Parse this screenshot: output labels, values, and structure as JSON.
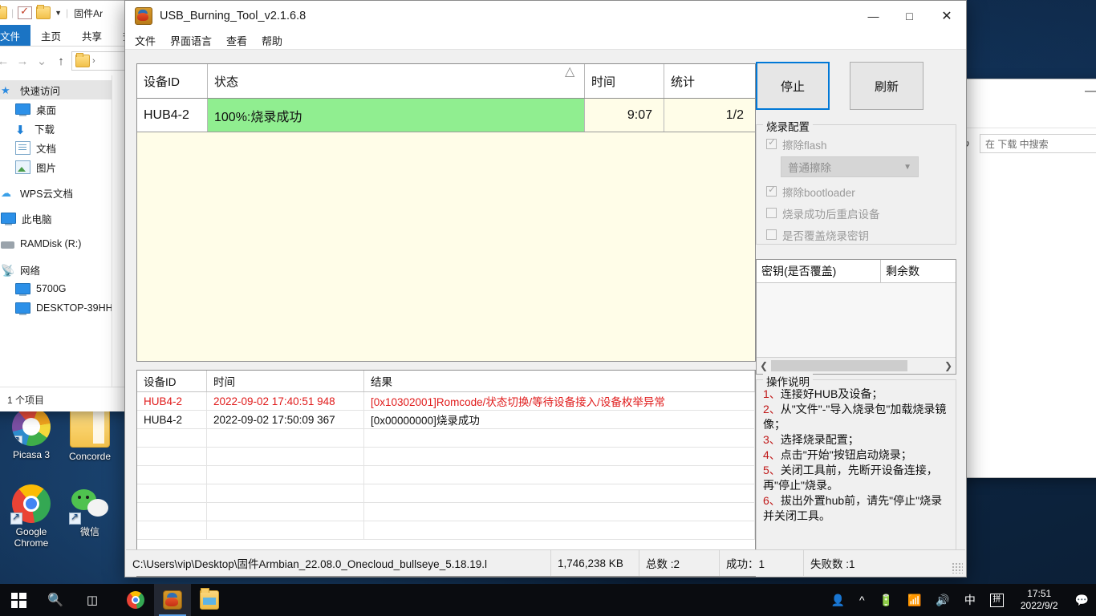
{
  "desktop": {
    "icons": [
      {
        "label": "Picasa 3",
        "icon": "picasa-icon"
      },
      {
        "label": "Concorde",
        "icon": "folder-icon"
      },
      {
        "label": "Google Chrome",
        "icon": "chrome-icon"
      },
      {
        "label": "微信",
        "icon": "wechat-icon"
      }
    ]
  },
  "explorer": {
    "title": "固件Ar",
    "quick_access_icons": [
      "folder-icon",
      "properties-icon",
      "new-folder-icon",
      "customize-caret-icon"
    ],
    "ribbon_tabs": [
      {
        "label": "文件",
        "active": true
      },
      {
        "label": "主页",
        "active": false
      },
      {
        "label": "共享",
        "active": false
      },
      {
        "label": "查看",
        "active": false
      }
    ],
    "nav": {
      "back": "←",
      "forward": "→",
      "recent": "⌄",
      "up": "↑",
      "path_chevron": "›"
    },
    "tree": [
      {
        "label": "快速访问",
        "icon": "pin-icon",
        "selected": true,
        "indent": false
      },
      {
        "label": "桌面",
        "icon": "desktop-icon",
        "selected": false,
        "indent": true
      },
      {
        "label": "下载",
        "icon": "download-icon",
        "selected": false,
        "indent": true
      },
      {
        "label": "文档",
        "icon": "documents-icon",
        "selected": false,
        "indent": true
      },
      {
        "label": "图片",
        "icon": "pictures-icon",
        "selected": false,
        "indent": true
      },
      {
        "label": "WPS云文档",
        "icon": "cloud-icon",
        "selected": false,
        "indent": false
      },
      {
        "label": "此电脑",
        "icon": "computer-icon",
        "selected": false,
        "indent": false
      },
      {
        "label": "RAMDisk (R:)",
        "icon": "drive-icon",
        "selected": false,
        "indent": false
      },
      {
        "label": "网络",
        "icon": "network-icon",
        "selected": false,
        "indent": false
      },
      {
        "label": "5700G",
        "icon": "computer-icon",
        "selected": false,
        "indent": true
      },
      {
        "label": "DESKTOP-39HH",
        "icon": "computer-icon",
        "selected": false,
        "indent": true
      }
    ],
    "status": "1 个项目"
  },
  "explorer2": {
    "minimize": "—",
    "refresh_icon": "refresh-icon",
    "search_placeholder": "在 下载 中搜索"
  },
  "usb_tool": {
    "title": "USB_Burning_Tool_v2.1.6.8",
    "app_icon": "usb-burning-tool-icon",
    "window_buttons": {
      "minimize": "—",
      "maximize": "□",
      "close": "✕"
    },
    "menu": [
      "文件",
      "界面语言",
      "查看",
      "帮助"
    ],
    "device_grid": {
      "headers": [
        "设备ID",
        "状态",
        "时间",
        "统计"
      ],
      "sort_indicator": "△",
      "rows": [
        {
          "id": "HUB4-2",
          "status": "100%:烧录成功",
          "time": "9:07",
          "stat": "1/2",
          "color": "#90ee90"
        }
      ]
    },
    "log_grid": {
      "headers": [
        "设备ID",
        "时间",
        "结果"
      ],
      "rows": [
        {
          "id": "HUB4-2",
          "time": "2022-09-02 17:40:51 948",
          "result": "[0x10302001]Romcode/状态切换/等待设备接入/设备枚举异常",
          "error": true
        },
        {
          "id": "HUB4-2",
          "time": "2022-09-02 17:50:09 367",
          "result": "[0x00000000]烧录成功",
          "error": false
        }
      ]
    },
    "buttons": {
      "stop": "停止",
      "refresh": "刷新"
    },
    "burn_config": {
      "title": "烧录配置",
      "options": [
        {
          "label": "擦除flash",
          "checked": true
        },
        {
          "label": "擦除bootloader",
          "checked": true
        },
        {
          "label": "烧录成功后重启设备",
          "checked": false
        },
        {
          "label": "是否覆盖烧录密钥",
          "checked": false
        }
      ],
      "erase_mode": "普通擦除"
    },
    "key_grid": {
      "headers": [
        "密钥(是否覆盖)",
        "剩余数"
      ]
    },
    "operations": {
      "title": "操作说明",
      "lines": [
        {
          "num": "1、",
          "text": "连接好HUB及设备；"
        },
        {
          "num": "2、",
          "text": "从\"文件\"-\"导入烧录包\"加载烧录镜像；"
        },
        {
          "num": "3、",
          "text": "选择烧录配置；"
        },
        {
          "num": "4、",
          "text": "点击\"开始\"按钮启动烧录；"
        },
        {
          "num": "5、",
          "text": "关闭工具前，先断开设备连接，再\"停止\"烧录。"
        },
        {
          "num": "6、",
          "text": "拔出外置hub前，请先\"停止\"烧录并关闭工具。"
        }
      ]
    },
    "status_bar": {
      "path": "C:\\Users\\vip\\Desktop\\固件Armbian_22.08.0_Onecloud_bullseye_5.18.19.l",
      "size": "1,746,238 KB",
      "total": "总数 :2",
      "success": "成功：1",
      "failed": "失败数 :1"
    }
  },
  "taskbar": {
    "start_icon": "windows-logo-icon",
    "search_icon": "search-icon",
    "taskview_icon": "task-view-icon",
    "pinned": [
      {
        "icon": "chrome-icon",
        "active": false
      },
      {
        "icon": "usb-burning-tool-icon",
        "active": true
      },
      {
        "icon": "file-explorer-icon",
        "active": false
      }
    ],
    "tray": {
      "people_icon": "people-icon",
      "chevron_icon": "show-hidden-icons-icon",
      "battery_icon": "battery-icon",
      "wifi_icon": "wifi-icon",
      "volume_icon": "volume-icon",
      "ime_mode": "中",
      "ime_pinyin": "拼",
      "time": "17:51",
      "date": "2022/9/2",
      "notification_icon": "notification-icon"
    }
  }
}
